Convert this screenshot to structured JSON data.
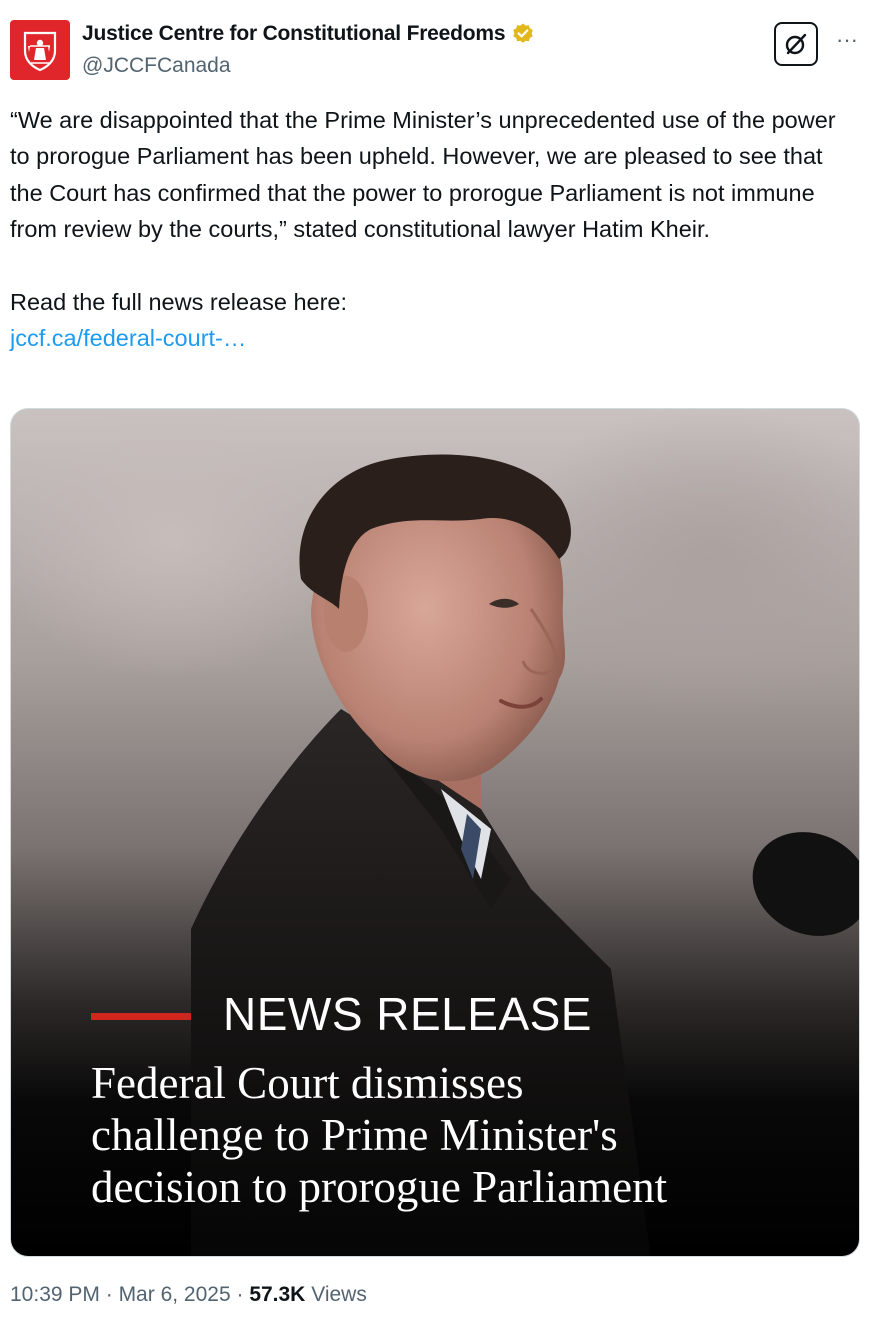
{
  "author": {
    "name": "Justice Centre for Constitutional Freedoms",
    "handle": "@JCCFCanada",
    "verified_color": "#e2b719",
    "avatar_color": "#e0262b"
  },
  "actions": {
    "grok_icon": "grok-icon",
    "more_label": "···"
  },
  "tweet": {
    "paragraphs": [
      "“We are disappointed that the Prime Minister’s unprecedented use of the power to prorogue Parliament has been upheld. However, we are pleased to see that the Court has confirmed that the power to prorogue Parliament is not immune from review by the courts,” stated constitutional lawyer Hatim Kheir.",
      "Read the full news release here:"
    ],
    "link_text": "jccf.ca/federal-court-…",
    "link_color": "#1d9bf0"
  },
  "media": {
    "label": "NEWS RELEASE",
    "accent_color": "#d0261e",
    "headline_lines": [
      "Federal Court dismisses",
      "challenge to Prime Minister's",
      "decision to prorogue Parliament"
    ]
  },
  "meta": {
    "time": "10:39 PM",
    "separator": " · ",
    "date": "Mar 6, 2025",
    "views_count": "57.3K",
    "views_label": " Views"
  }
}
